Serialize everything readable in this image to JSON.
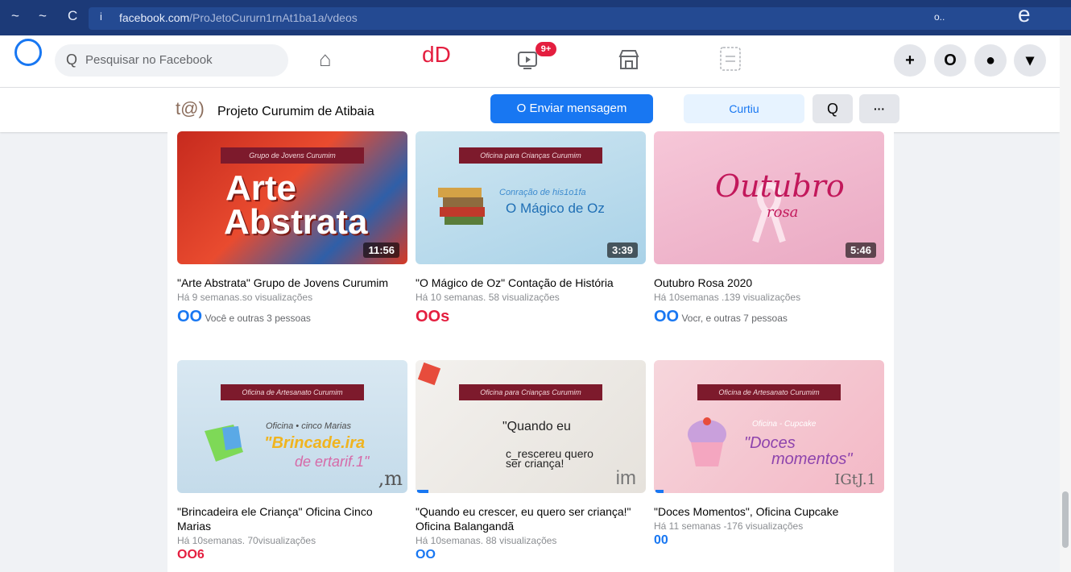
{
  "browser": {
    "nav_back": "~",
    "nav_forward": "~",
    "nav_reload": "C",
    "info": "i",
    "url_host": "facebook.com",
    "url_path": "/ProJetoCururn1rnAt1ba1a/vdeos",
    "right_text": "o..",
    "right_icon": "e"
  },
  "topbar": {
    "search_icon": "Q",
    "search_placeholder": "Pesquisar no Facebook",
    "home_icon": "⌂",
    "center_text": "dD",
    "watch_badge": "9+",
    "plus": "+",
    "btn2": "O",
    "btn3": "●",
    "btn4": "▾"
  },
  "page_header": {
    "page_icon_text": "t@)",
    "page_name": "Projeto Curumim de Atibaia",
    "send_message": "O Enviar mensagem",
    "liked": "Curtiu",
    "search": "Q",
    "more": "···"
  },
  "videos": [
    {
      "banner": "Grupo de Jovens Curumim",
      "overlay_line1": "Arte",
      "overlay_line2": "Abstrata",
      "duration": "11:56",
      "title": "\"Arte Abstrata\" Grupo de Jovens Curumim",
      "meta": "Há 9 semanas.so visualizações",
      "reactions_icons": "OO",
      "reactions_text": "Você e outras 3 pessoas"
    },
    {
      "banner": "Oficina para Crianças Curumim",
      "overlay_line1": "Conração de his1o1fa",
      "overlay_line2": "O Mágico de Oz",
      "duration": "3:39",
      "title": "\"O Mágico de Oz\" Contação de História",
      "meta": "Há 10 semanas. 58 visualizações",
      "reactions_icons": "OOs",
      "reactions_text": ""
    },
    {
      "banner": "",
      "overlay_line1": "Outubro",
      "overlay_line2": "rosa",
      "duration": "5:46",
      "title": "Outubro Rosa 2020",
      "meta": "Há 10semanas .139 visualizações",
      "reactions_icons": "OO",
      "reactions_text": "Vocr, e outras 7 pessoas"
    },
    {
      "banner": "Oficina de Artesanato Curumim",
      "overlay_line1": "Oficina • cinco Marias",
      "overlay_line2": "\"Brincade.ira",
      "overlay_line3": "de ertarif.1\"",
      "duration": ",m",
      "title": "\"Brincadeira ele Criança\" Oficina Cinco Marias",
      "meta": "Há 10semanas. 70visualizações",
      "reactions_icons": "OO6",
      "reactions_text": ""
    },
    {
      "banner": "Oficina para Crianças Curumim",
      "overlay_line1": "\"Quando eu",
      "overlay_line2": "c_rescereu quero",
      "overlay_line3": "ser criança!",
      "duration": "im",
      "title": "\"Quando eu crescer, eu quero ser criança!\" Oficina Balangandã",
      "meta": "Há 10semanas. 88 visualizações",
      "reactions_icons": "OO",
      "reactions_text": ""
    },
    {
      "banner": "Oficina de Artesanato Curumim",
      "overlay_line1": "Oficina - Cupcake",
      "overlay_line2": "\"Doces",
      "overlay_line3": "momentos\"",
      "duration": "IGtJ.1",
      "title": "\"Doces Momentos\", Oficina Cupcake",
      "meta": "Há 11 semanas -176 visualizações",
      "reactions_icons": "00",
      "reactions_text": ""
    }
  ]
}
